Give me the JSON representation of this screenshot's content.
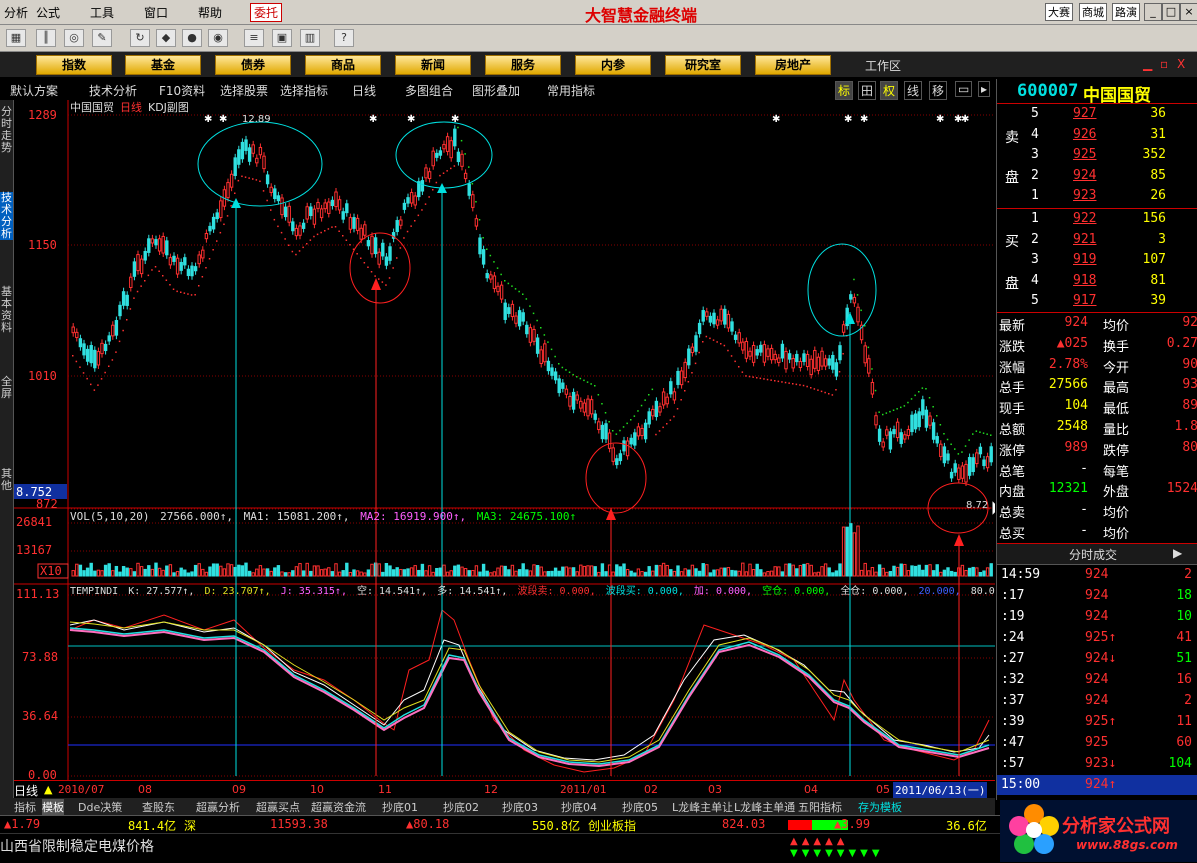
{
  "menu": {
    "items": [
      "分析",
      "公式",
      "工具",
      "窗口",
      "帮助"
    ],
    "trade_button": "委托",
    "app_title": "大智慧金融终端",
    "right_buttons": [
      "大赛",
      "商城",
      "路演"
    ]
  },
  "categories": [
    "指数",
    "基金",
    "债券",
    "商品",
    "新闻",
    "服务",
    "内参",
    "研究室",
    "房地产"
  ],
  "category_bar": {
    "workspace": "工作区",
    "close_btn": "X"
  },
  "tabbar": {
    "items": [
      "默认方案",
      "技术分析",
      "F10资料",
      "选择股票",
      "选择指标",
      "日线",
      "多图组合",
      "图形叠加",
      "常用指标"
    ],
    "right_items": [
      "标",
      "田",
      "权",
      "线",
      "移"
    ]
  },
  "sidebar": {
    "items": [
      "分时走势",
      "技术分析",
      "基本资料",
      "全屏",
      "其他"
    ]
  },
  "chart": {
    "title": "中国国贸",
    "period": "日线",
    "subtitle": "KDJ副图",
    "price_labels": [
      "1289",
      "1150",
      "1010",
      "8.752",
      "872"
    ],
    "high_annot": "12.89",
    "low_annot": "8.72",
    "vol_line": {
      "label": "VOL(5,10,20)",
      "value": "27566.000↑,",
      "ma1": "MA1: 15081.200↑,",
      "ma2": "MA2: 16919.900↑,",
      "ma3": "MA3: 24675.100↑"
    },
    "vol_labels": [
      "26841",
      "13167",
      "X10"
    ],
    "ind_line": {
      "label": "TEMPINDI",
      "k": "K: 27.577↑,",
      "d": "D: 23.707↑,",
      "j": "J: 35.315↑,",
      "kong": "空: 14.541↑,",
      "duo": "多: 14.541↑,",
      "bdm": "波段卖: 0.000,",
      "bdmr": "波段买: 0.000,",
      "jia": "加: 0.000,",
      "kongcang": "空仓: 0.000,",
      "quancang": "全仓: 0.000,",
      "v20": "20.000,",
      "v80": "80.000"
    },
    "ind_labels": [
      "111.13",
      "73.88",
      "36.64",
      "0.00"
    ]
  },
  "datebar": {
    "period": "日线",
    "labels": [
      "2010/07",
      "08",
      "09",
      "10",
      "11",
      "12",
      "2011/01",
      "02",
      "03",
      "04",
      "05"
    ],
    "cursor_date": "2011/06/13(一)"
  },
  "bottom_tabs": [
    "指标",
    "模板",
    "Dde决策",
    "查股东",
    "超赢分析",
    "超赢买点",
    "超赢资金流",
    "抄底01",
    "抄底02",
    "抄底03",
    "抄底04",
    "抄底05",
    "L龙峰主单让",
    "L龙峰主单通",
    "五阳指标",
    "存为模板"
  ],
  "statusbar": {
    "s1_change": "▲1.79",
    "s1_amount": "841.4亿",
    "s1_label": "深",
    "s2_index": "11593.38",
    "s2_change": "▲80.18",
    "s2_amount": "550.8亿",
    "s3_label": "创业板指",
    "s3_index": "824.03",
    "s3_change": "▲3.99",
    "s3_amount": "36.6亿"
  },
  "news": "山西省限制稳定电煤价格",
  "quote": {
    "code": "600007",
    "name": "中国国贸",
    "sell_label": [
      "卖",
      "盘"
    ],
    "buy_label": [
      "买",
      "盘"
    ],
    "sells": [
      {
        "lvl": "5",
        "price": "927",
        "vol": "36"
      },
      {
        "lvl": "4",
        "price": "926",
        "vol": "31"
      },
      {
        "lvl": "3",
        "price": "925",
        "vol": "352"
      },
      {
        "lvl": "2",
        "price": "924",
        "vol": "85"
      },
      {
        "lvl": "1",
        "price": "923",
        "vol": "26"
      }
    ],
    "buys": [
      {
        "lvl": "1",
        "price": "922",
        "vol": "156"
      },
      {
        "lvl": "2",
        "price": "921",
        "vol": "3"
      },
      {
        "lvl": "3",
        "price": "919",
        "vol": "107"
      },
      {
        "lvl": "4",
        "price": "918",
        "vol": "81"
      },
      {
        "lvl": "5",
        "price": "917",
        "vol": "39"
      }
    ],
    "stats": [
      {
        "k1": "最新",
        "v1": "924",
        "k2": "均价",
        "v2": "92"
      },
      {
        "k1": "涨跌",
        "v1": "▲025",
        "k2": "换手",
        "v2": "0.27"
      },
      {
        "k1": "涨幅",
        "v1": "2.78%",
        "k2": "今开",
        "v2": "90"
      },
      {
        "k1": "总手",
        "v1": "27566",
        "k2": "最高",
        "v2": "93"
      },
      {
        "k1": "现手",
        "v1": "104",
        "k2": "最低",
        "v2": "89"
      },
      {
        "k1": "总额",
        "v1": "2548",
        "k2": "量比",
        "v2": "1.8"
      },
      {
        "k1": "涨停",
        "v1": "989",
        "k2": "跌停",
        "v2": "80"
      },
      {
        "k1": "总笔",
        "v1": "-",
        "k2": "每笔",
        "v2": ""
      },
      {
        "k1": "内盘",
        "v1": "12321",
        "k2": "外盘",
        "v2": "1524"
      },
      {
        "k1": "总卖",
        "v1": "-",
        "k2": "均价",
        "v2": ""
      },
      {
        "k1": "总买",
        "v1": "-",
        "k2": "均价",
        "v2": ""
      }
    ],
    "ticks_title": "分时成交",
    "ticks": [
      {
        "t": "14:59",
        "p": "924",
        "v": "2",
        "c": "red"
      },
      {
        "t": ":17",
        "p": "924",
        "v": "18",
        "c": "green"
      },
      {
        "t": ":19",
        "p": "924",
        "v": "10",
        "c": "green"
      },
      {
        "t": ":24",
        "p": "925↑",
        "v": "41",
        "c": "red"
      },
      {
        "t": ":27",
        "p": "924↓",
        "v": "51",
        "c": "green"
      },
      {
        "t": ":32",
        "p": "924",
        "v": "16",
        "c": "red"
      },
      {
        "t": ":37",
        "p": "924",
        "v": "2",
        "c": "red"
      },
      {
        "t": ":39",
        "p": "925↑",
        "v": "11",
        "c": "red"
      },
      {
        "t": ":47",
        "p": "925",
        "v": "60",
        "c": "red"
      },
      {
        "t": ":57",
        "p": "923↓",
        "v": "104",
        "c": "green"
      },
      {
        "t": "15:00",
        "p": "924↑",
        "v": "",
        "c": "red"
      }
    ]
  },
  "logo": {
    "text": "分析家公式网",
    "url": "www.88gs.com"
  }
}
